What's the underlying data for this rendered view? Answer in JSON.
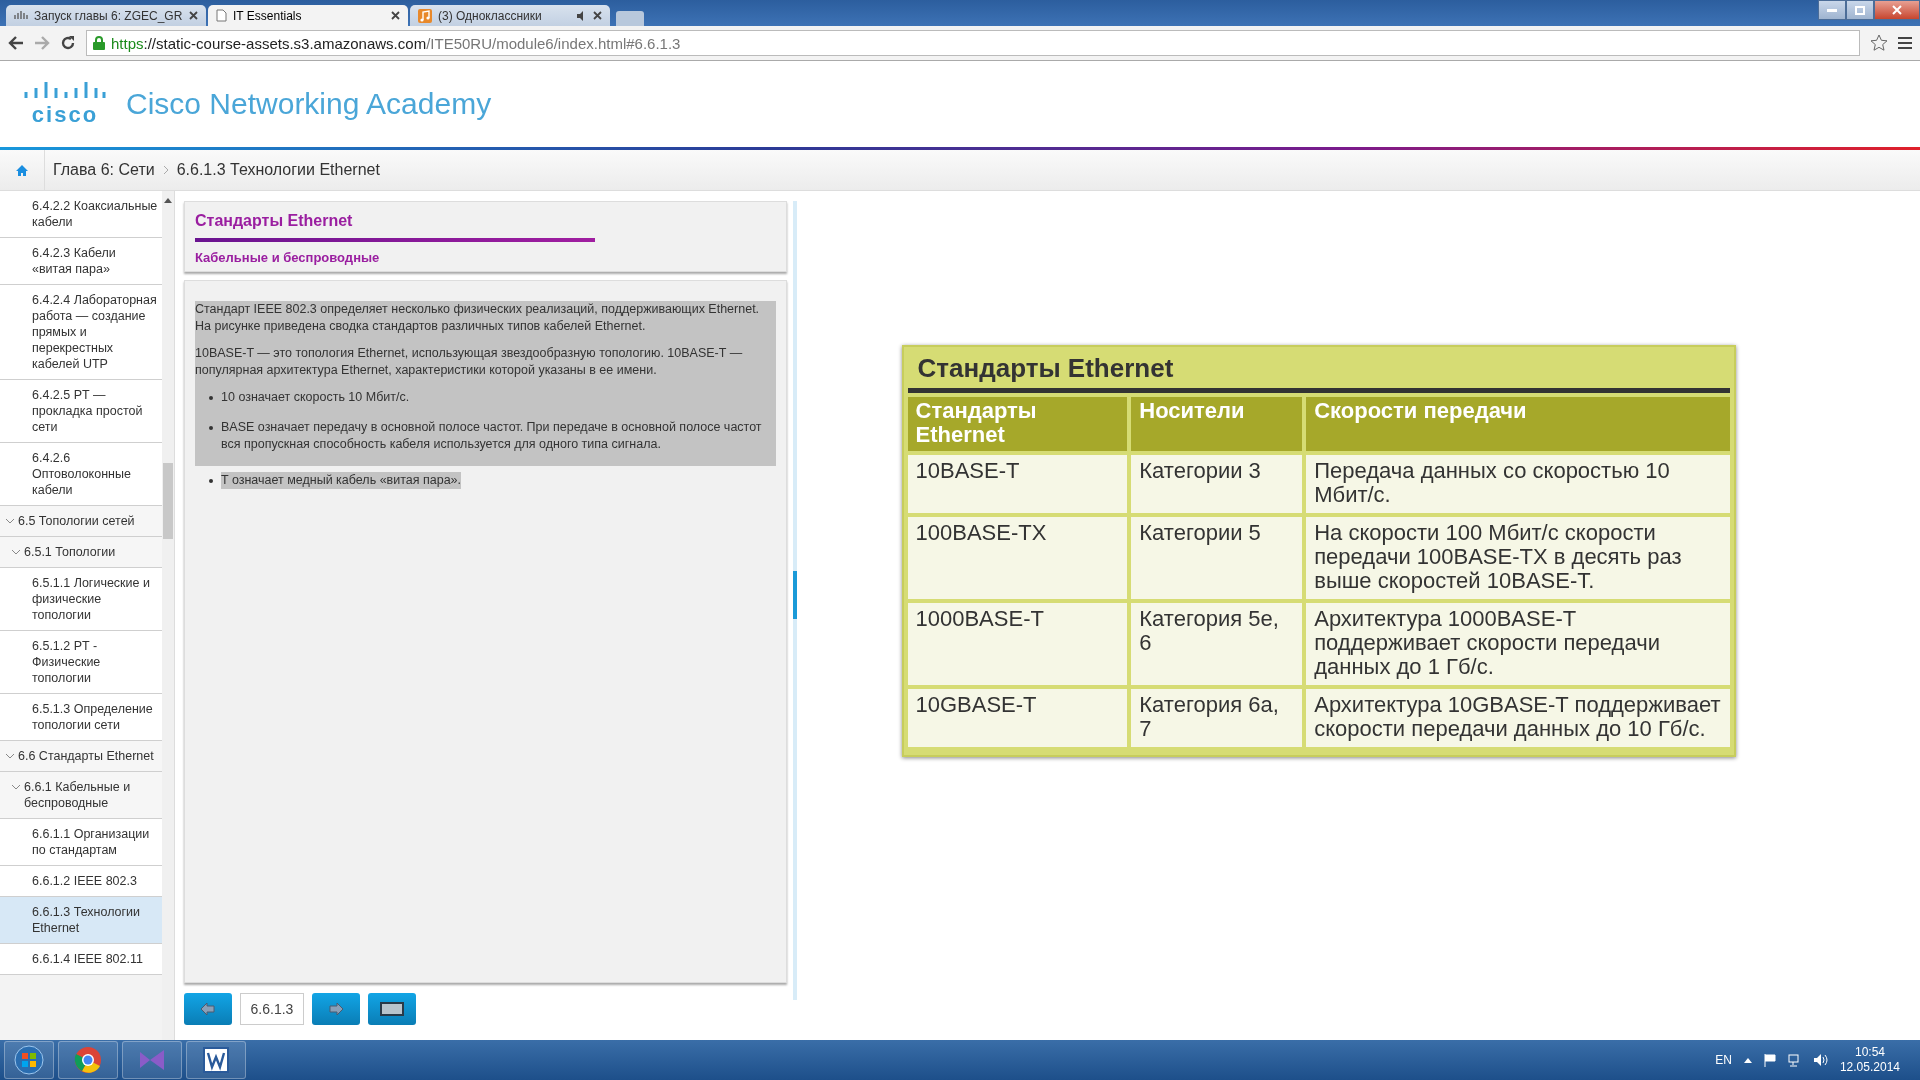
{
  "browser": {
    "tabs": [
      {
        "title": "Запуск главы 6: ZGEC_GR",
        "selected": false,
        "kind": "cisco"
      },
      {
        "title": "IT Essentials",
        "selected": true,
        "kind": "page"
      },
      {
        "title": "(3) Одноклассники",
        "selected": false,
        "kind": "music"
      }
    ],
    "url": {
      "scheme": "https",
      "host": "://static-course-assets.s3.amazonaws.com",
      "path": "/ITE50RU/module6/index.html#6.6.1.3"
    }
  },
  "header": {
    "brand": "Cisco Networking Academy",
    "logo_word": "cisco"
  },
  "breadcrumb": [
    "Глава 6: Сети",
    "6.6.1.3 Технологии Ethernet"
  ],
  "sidebar": {
    "items": [
      {
        "label": "6.4.2.2 Коаксиальные кабели",
        "selected": false
      },
      {
        "label": "6.4.2.3 Кабели «витая пара»",
        "selected": false
      },
      {
        "label": "6.4.2.4 Лабораторная работа — создание прямых и перекрестных кабелей UTP",
        "selected": false
      },
      {
        "label": "6.4.2.5 PT — прокладка простой сети",
        "selected": false
      },
      {
        "label": "6.4.2.6 Оптоволоконные кабели",
        "selected": false
      },
      {
        "label": "6.5 Топологии сетей",
        "selected": false,
        "expanded": true,
        "children": [
          {
            "label": "6.5.1 Топологии",
            "selected": false,
            "expanded": true,
            "children": [
              {
                "label": "6.5.1.1 Логические и физические топологии",
                "selected": false
              },
              {
                "label": "6.5.1.2 PT - Физические топологии",
                "selected": false
              },
              {
                "label": "6.5.1.3 Определение топологии сети",
                "selected": false
              }
            ]
          }
        ]
      },
      {
        "label": "6.6 Стандарты Ethernet",
        "selected": false,
        "expanded": true,
        "children": [
          {
            "label": "6.6.1 Кабельные и беспроводные",
            "selected": false,
            "expanded": true,
            "children": [
              {
                "label": "6.6.1.1 Организации по стандартам",
                "selected": false
              },
              {
                "label": "6.6.1.2 IEEE 802.3",
                "selected": false
              },
              {
                "label": "6.6.1.3 Технологии Ethernet",
                "selected": true
              },
              {
                "label": "6.6.1.4 IEEE 802.11",
                "selected": false
              }
            ]
          }
        ]
      }
    ]
  },
  "content": {
    "title": "Стандарты Ethernet",
    "subtitle": "Кабельные и беспроводные",
    "paragraphs": [
      "Стандарт IEEE 802.3 определяет несколько физических реализаций, поддерживающих Ethernet. На рисунке приведена сводка стандартов различных типов кабелей Ethernet.",
      "10BASE-T — это топология Ethernet, использующая звездообразную топологию. 10BASE-T — популярная архитектура Ethernet, характеристики которой указаны в ее имени."
    ],
    "bullets": [
      "10 означает скорость 10 Мбит/с.",
      "BASE означает передачу в основной полосе частот. При передаче в основной полосе частот вся пропускная способность кабеля используется для одного типа сигнала.",
      "T означает медный кабель «витая пара»."
    ]
  },
  "figure": {
    "title": "Стандарты Ethernet",
    "columns": [
      "Стандарты Ethernet",
      "Носители",
      "Скорости передачи"
    ],
    "rows": [
      [
        "10BASE-T",
        "Категории 3",
        "Передача данных со скоростью 10 Мбит/с."
      ],
      [
        "100BASE-TX",
        "Категории 5",
        "На скорости 100 Мбит/с скорости передачи 100BASE-TX в десять раз выше скоростей 10BASE-T."
      ],
      [
        "1000BASE-T",
        "Категория 5e, 6",
        "Архитектура 1000BASE-T поддерживает скорости передачи данных до 1 Гб/с."
      ],
      [
        "10GBASE-T",
        "Категория 6а, 7",
        "Архитектура 10GBASE-T поддерживает скорости передачи данных до 10 Гб/с."
      ]
    ]
  },
  "navigation": {
    "page": "6.6.1.3"
  },
  "taskbar": {
    "language": "EN",
    "time": "10:54",
    "date": "12.05.2014"
  }
}
